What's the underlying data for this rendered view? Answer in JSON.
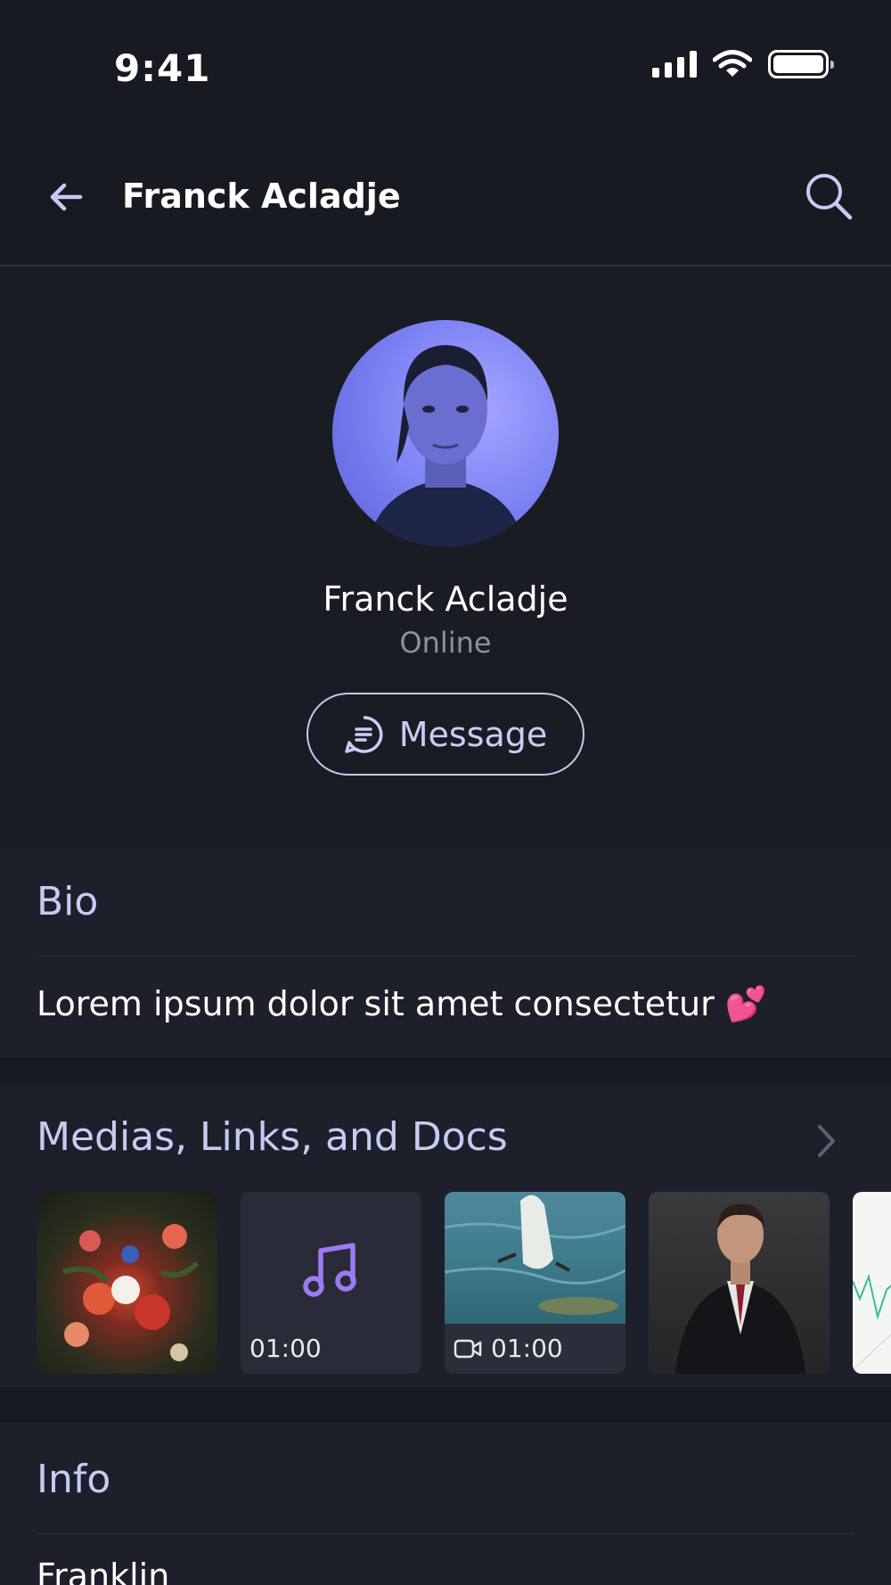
{
  "status_bar": {
    "time": "9:41"
  },
  "app_bar": {
    "title": "Franck Acladje"
  },
  "profile": {
    "name": "Franck Acladje",
    "status": "Online",
    "message_label": "Message"
  },
  "bio": {
    "title": "Bio",
    "text": "Lorem ipsum dolor sit amet consectetur",
    "emoji": "💕"
  },
  "media": {
    "title": "Medias, Links, and Docs",
    "items": [
      {
        "kind": "image",
        "subject": "flower-painting"
      },
      {
        "kind": "audio",
        "duration": "01:00"
      },
      {
        "kind": "video",
        "duration": "01:00",
        "subject": "swan"
      },
      {
        "kind": "image",
        "subject": "man-in-suit"
      },
      {
        "kind": "document",
        "subject": "chart"
      }
    ]
  },
  "info": {
    "title": "Info",
    "first_value": "Franklin"
  },
  "colors": {
    "background": "#181a22",
    "section": "#1d1f2a",
    "accent": "#c7cbf2",
    "music_icon": "#9b7cf0"
  },
  "icons": [
    "back-arrow-icon",
    "search-icon",
    "message-icon",
    "music-note-icon",
    "video-camera-icon",
    "chevron-right-icon",
    "signal-icon",
    "wifi-icon",
    "battery-icon"
  ]
}
